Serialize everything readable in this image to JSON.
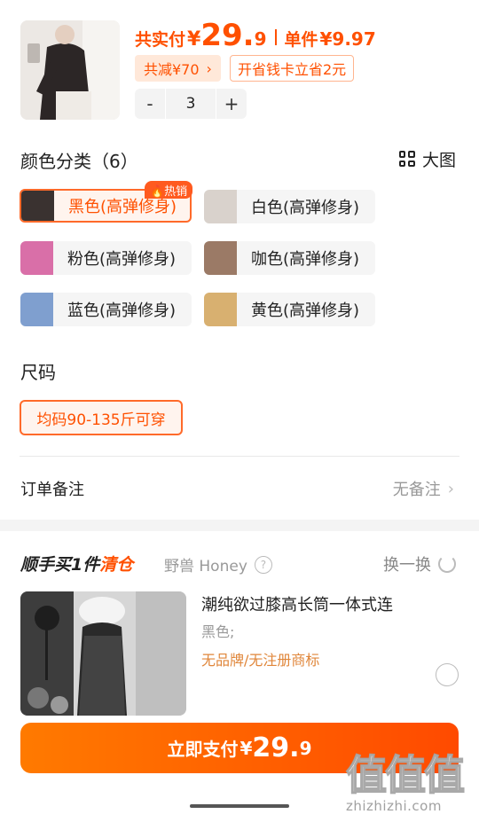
{
  "summary": {
    "total_label": "共实付",
    "currency": "¥",
    "total_int": "29.",
    "total_dec": "9",
    "unit_label": "单件",
    "unit_price": "¥9.97",
    "discount_label": "共减¥70",
    "discount_chevron": "›",
    "card_label": "开省钱卡立省2元",
    "stepper": {
      "minus": "-",
      "quantity": "3",
      "plus": "+"
    }
  },
  "color_section": {
    "title": "颜色分类（6）",
    "big_image_label": "大图",
    "hot_badge": "🔥热销",
    "options": [
      {
        "label": "黑色(高弹修身)",
        "swatch_color": "#3a3230",
        "selected": true
      },
      {
        "label": "白色(高弹修身)",
        "swatch_color": "#d9d2cc",
        "selected": false
      },
      {
        "label": "粉色(高弹修身)",
        "swatch_color": "#d96fa8",
        "selected": false
      },
      {
        "label": "咖色(高弹修身)",
        "swatch_color": "#9b7a66",
        "selected": false
      },
      {
        "label": "蓝色(高弹修身)",
        "swatch_color": "#7f9fcf",
        "selected": false
      },
      {
        "label": "黄色(高弹修身)",
        "swatch_color": "#d8b070",
        "selected": false
      }
    ]
  },
  "size_section": {
    "title": "尺码",
    "option": "均码90-135斤可穿"
  },
  "order_note": {
    "label": "订单备注",
    "value": "无备注",
    "chevron": "›"
  },
  "addon": {
    "title_main": "顺手买1件",
    "title_accent": "清仓",
    "shop": "野兽 Honey",
    "help_icon_text": "?",
    "swap_label": "换一换",
    "item_name": "潮纯欲过膝高长筒一体式连",
    "item_color": "黑色;",
    "item_brand": "无品牌/无注册商标"
  },
  "pay": {
    "label": "立即支付",
    "currency": "¥",
    "amount_int": "29.",
    "amount_dec": "9"
  },
  "watermark": {
    "glyphs": "值值值",
    "url": "zhizhizhi.com"
  },
  "colors": {
    "accent": "#ff5000",
    "accent_light": "#fff4ee",
    "chip_bg": "#f5f5f5"
  }
}
